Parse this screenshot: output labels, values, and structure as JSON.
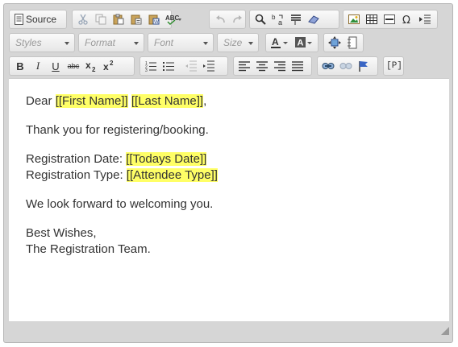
{
  "toolbar": {
    "source_label": "Source",
    "styles_placeholder": "Styles",
    "format_placeholder": "Format",
    "font_placeholder": "Font",
    "size_placeholder": "Size",
    "bold_label": "B",
    "italic_label": "I",
    "underline_label": "U",
    "strike_label": "abc",
    "placeholder_label": "[P]"
  },
  "content": {
    "greeting_prefix": "Dear ",
    "first_name": "[[First Name]]",
    "space": " ",
    "last_name": "[[Last Name]]",
    "greeting_suffix": ",",
    "thanks": "Thank you for registering/booking.",
    "reg_date_label": "Registration Date: ",
    "reg_date_value": "[[Todays Date]]",
    "reg_type_label": "Registration Type: ",
    "reg_type_value": "[[Attendee Type]]",
    "closing": "We look forward to welcoming you.",
    "signoff": "Best Wishes,",
    "signature": "The Registration Team."
  },
  "colors": {
    "highlight": "#ffff66",
    "frame": "#d6d6d6"
  }
}
